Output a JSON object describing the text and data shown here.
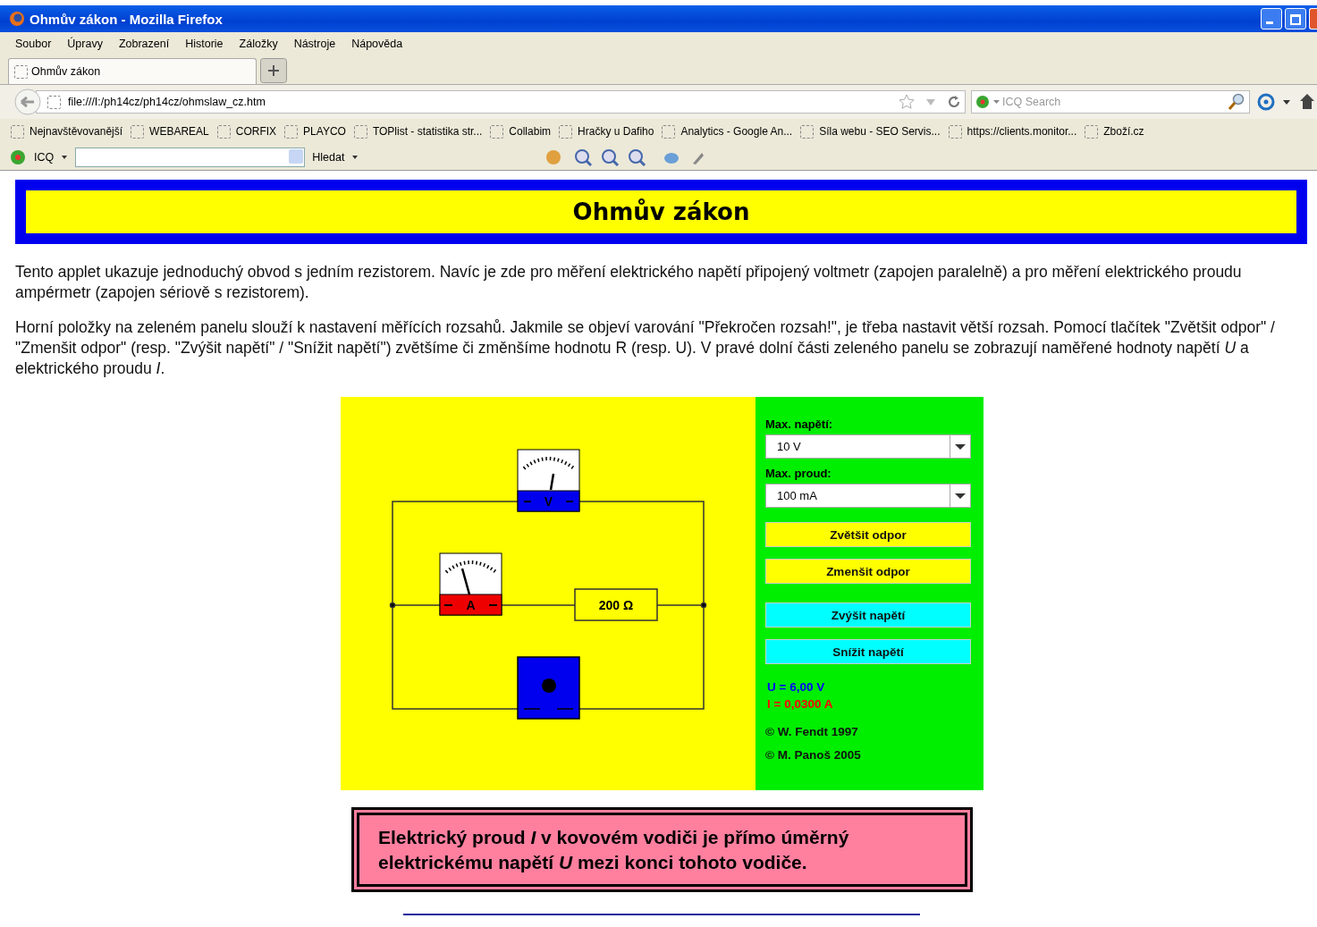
{
  "window": {
    "title": "Ohmův zákon - Mozilla Firefox"
  },
  "menu": [
    "Soubor",
    "Úpravy",
    "Zobrazení",
    "Historie",
    "Záložky",
    "Nástroje",
    "Nápověda"
  ],
  "tabs": [
    {
      "label": "Ohmův zákon",
      "selected": true
    }
  ],
  "address": {
    "url": "file:///I:/ph14cz/ph14cz/ohmslaw_cz.htm"
  },
  "search": {
    "placeholder": "ICQ Search"
  },
  "bookmarks": [
    "Nejnavštěvovanější",
    "WEBAREAL",
    "CORFIX",
    "PLAYCO",
    "TOPlist - statistika str...",
    "Collabim",
    "Hračky u Dafiho",
    "Analytics - Google An...",
    "Síla webu - SEO Servis...",
    "https://clients.monitor...",
    "Zboží.cz"
  ],
  "icq_toolbar": {
    "label": "ICQ",
    "search_button": "Hledat"
  },
  "page": {
    "heading": "Ohmův zákon",
    "paragraphs": [
      "Tento applet ukazuje jednoduchý obvod s jedním rezistorem. Navíc je zde pro měření elektrického napětí připojený voltmetr (zapojen paralelně) a pro měření elektrického proudu ampérmetr (zapojen sériově s rezistorem).",
      "Horní položky na zeleném panelu slouží k nastavení měřících rozsahů. Jakmile se objeví varování \"Překročen rozsah!\", je třeba nastavit větší rozsah. Pomocí tlačítek \"Zvětšit odpor\" / \"Zmenšit odpor\" (resp. \"Zvýšit napětí\" / \"Snížit napětí\") zvětšíme či změnšíme hodnotu R (resp. U). V pravé dolní části zeleného panelu se zobrazují naměřené hodnoty napětí *U* a elektrického proudu *I*."
    ],
    "applet": {
      "voltmeter_label": "V",
      "ammeter_label": "A",
      "resistor_label": "200 Ω",
      "selects": [
        {
          "label": "Max. napětí:",
          "value": "10 V"
        },
        {
          "label": "Max. proud:",
          "value": "100 mA"
        }
      ],
      "buttons": [
        {
          "label": "Zvětšit odpor",
          "color": "#ffff00"
        },
        {
          "label": "Zmenšit odpor",
          "color": "#ffff00"
        },
        {
          "label": "Zvýšit napětí",
          "color": "#00ffff"
        },
        {
          "label": "Snížit napětí",
          "color": "#00ffff"
        }
      ],
      "readings": [
        {
          "text": "U = 6,00 V",
          "color": "#0000ff"
        },
        {
          "text": "I = 0,0300 A",
          "color": "#ff0000"
        }
      ],
      "credits": [
        "© W. Fendt 1997",
        "© M. Panoš 2005"
      ]
    },
    "law": "Elektrický proud *I* v kovovém vodiči je přímo úměrný elektrickému napětí *U* mezi konci tohoto vodiče."
  }
}
